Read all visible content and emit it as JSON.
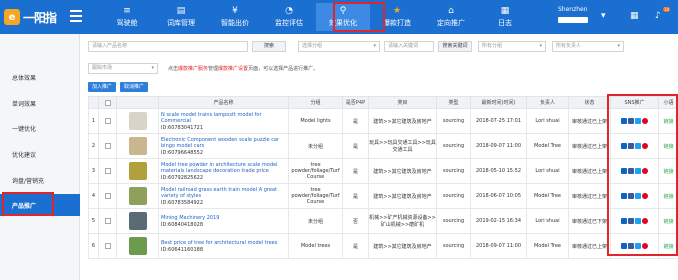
{
  "header": {
    "logo_mark": "e",
    "logo_text": "一阳指",
    "nav": [
      {
        "label": "驾驶舱",
        "icon": "≡"
      },
      {
        "label": "词库管理",
        "icon": "▤"
      },
      {
        "label": "智能出价",
        "icon": "¥"
      },
      {
        "label": "监控评估",
        "icon": "◔"
      },
      {
        "label": "效果优化",
        "icon": "⚲"
      },
      {
        "label": "爆款打造",
        "icon": "★"
      },
      {
        "label": "定向推广",
        "icon": "⌂"
      },
      {
        "label": "日志",
        "icon": "▦"
      }
    ],
    "active_index": 4,
    "user_name": "Shenzhen",
    "grid_icon": "▦",
    "bell_icon": "🔔",
    "notification_count": "14"
  },
  "sidebar": {
    "items": [
      "总体效果",
      "单词效果",
      "一键优化",
      "优化建议",
      "询盘/营销充",
      "产品推广"
    ],
    "active_index": 5
  },
  "filters": {
    "product_placeholder": "请输入产品名称",
    "search_label": "搜索",
    "group_select": "选择分组",
    "keyword_placeholder": "请输入关键词",
    "search_keyword_btn": "搜索关键词",
    "all_groups": "所有分组",
    "all_managers": "所有负责人",
    "market_select": "跟踪市场",
    "notice_prefix": "点击",
    "notice_link1": "爆款推广服务",
    "notice_mid": "管理",
    "notice_link2": "爆款推广设置",
    "notice_suffix": "页面，可以选择产品进行推广。"
  },
  "actions": {
    "add_btn": "加入推广",
    "remove_btn": "取消推广"
  },
  "table": {
    "headers": [
      "",
      "",
      "",
      "产品名称",
      "分组",
      "是否P4P",
      "类目",
      "类型",
      "最新时间(时间)",
      "负责人",
      "状态",
      "SNS推广",
      "小语"
    ],
    "rows": [
      {
        "num": "1",
        "name": "N scale model trains lampostt model for Commercial",
        "id": "ID:60783041721",
        "group": "Model lights",
        "p4p": "是",
        "category": "建筑>>其它建筑及房地产",
        "type": "sourcing",
        "time": "2018-07-25 17:01",
        "owner": "Lori shuai",
        "status": "审核通过已上架",
        "thumb": "#d9d4c7",
        "small": "链接"
      },
      {
        "num": "2",
        "name": "Electronic Component wooden scale puzzle car bingo model cars",
        "id": "ID:60796648552",
        "group": "未分组",
        "p4p": "是",
        "category": "玩具>>玩具交通工具>>玩具交通工具",
        "type": "sourcing",
        "time": "2018-09-07 11:00",
        "owner": "Model Tree",
        "status": "审核通过已上架",
        "thumb": "#c9b58e",
        "small": "链接"
      },
      {
        "num": "3",
        "name": "Model tree powder in architecture scale model materials landscape decoration trade price",
        "id": "ID:60792825622",
        "group": "tree powder/foliage/Turf Course",
        "p4p": "是",
        "category": "建筑>>其它建筑及房地产",
        "type": "sourcing",
        "time": "2018-05-10 15:52",
        "owner": "Lori shuai",
        "status": "审核通过已上架",
        "thumb": "#b0a13c",
        "small": "链接"
      },
      {
        "num": "4",
        "name": "Model railroad grass earth train model A great variety of styles",
        "id": "ID:60783584922",
        "group": "tree powder/foliage/Turf Course",
        "p4p": "是",
        "category": "建筑>>其它建筑及房地产",
        "type": "sourcing",
        "time": "2018-06-07 10:05",
        "owner": "Model Tree",
        "status": "审核通过已上架",
        "thumb": "#8fa05a",
        "small": "链接"
      },
      {
        "num": "5",
        "name": "Mining Machinery 2019",
        "id": "ID:60840418028",
        "group": "未分组",
        "p4p": "否",
        "category": "机械>>矿产机械资源设备>>矿山机械>>磨矿机",
        "type": "sourcing",
        "time": "2019-02-15 16:34",
        "owner": "Lori shuai",
        "status": "审核通过已下架",
        "thumb": "#5b6b75",
        "small": "链接"
      },
      {
        "num": "6",
        "name": "Best price of tree for architectural model trees",
        "id": "ID:60641160188",
        "group": "Model trees",
        "p4p": "是",
        "category": "建筑>>其它建筑及房地产",
        "type": "sourcing",
        "time": "2018-09-07 11:00",
        "owner": "Model Tree",
        "status": "审核通过已上架",
        "thumb": "#6c9a4f",
        "small": "链接"
      }
    ]
  },
  "sns_icons": [
    "linkedin-icon",
    "facebook-icon",
    "twitter-icon",
    "pinterest-icon"
  ],
  "colors": {
    "brand": "#1b6fd0",
    "highlight": "#e0262a",
    "link": "#1f62c9"
  }
}
